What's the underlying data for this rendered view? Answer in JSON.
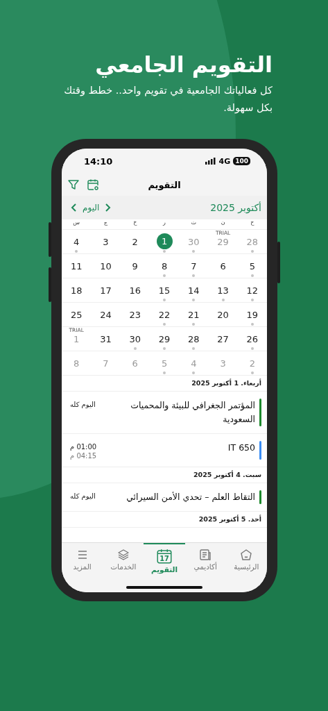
{
  "headline": {
    "title": "التقويم الجامعي",
    "subtitle": "كل فعالياتك الجامعية في تقويم واحد.. خطط وقتك بكل سهولة."
  },
  "status_bar": {
    "time": "14:10",
    "network": "4G",
    "battery": "100"
  },
  "header": {
    "title": "التقويم"
  },
  "month_bar": {
    "month": "أكتوبر 2025",
    "today": "اليوم"
  },
  "weekdays": [
    "ح",
    "ن",
    "ث",
    "ر",
    "خ",
    "ج",
    "س"
  ],
  "days": [
    {
      "day": "28",
      "muted": true,
      "dot": true,
      "selected": false
    },
    {
      "day": "29",
      "muted": true,
      "dot": false,
      "selected": false,
      "tag": "TRIAL"
    },
    {
      "day": "30",
      "muted": true,
      "dot": true,
      "selected": false
    },
    {
      "day": "1",
      "muted": false,
      "dot": true,
      "selected": true
    },
    {
      "day": "2",
      "muted": false,
      "dot": false,
      "selected": false
    },
    {
      "day": "3",
      "muted": false,
      "dot": false,
      "selected": false
    },
    {
      "day": "4",
      "muted": false,
      "dot": true,
      "selected": false
    },
    {
      "day": "5",
      "muted": false,
      "dot": true,
      "selected": false
    },
    {
      "day": "6",
      "muted": false,
      "dot": false,
      "selected": false
    },
    {
      "day": "7",
      "muted": false,
      "dot": true,
      "selected": false
    },
    {
      "day": "8",
      "muted": false,
      "dot": true,
      "selected": false
    },
    {
      "day": "9",
      "muted": false,
      "dot": false,
      "selected": false
    },
    {
      "day": "10",
      "muted": false,
      "dot": false,
      "selected": false
    },
    {
      "day": "11",
      "muted": false,
      "dot": false,
      "selected": false
    },
    {
      "day": "12",
      "muted": false,
      "dot": true,
      "selected": false
    },
    {
      "day": "13",
      "muted": false,
      "dot": true,
      "selected": false
    },
    {
      "day": "14",
      "muted": false,
      "dot": true,
      "selected": false
    },
    {
      "day": "15",
      "muted": false,
      "dot": true,
      "selected": false
    },
    {
      "day": "16",
      "muted": false,
      "dot": false,
      "selected": false
    },
    {
      "day": "17",
      "muted": false,
      "dot": false,
      "selected": false
    },
    {
      "day": "18",
      "muted": false,
      "dot": false,
      "selected": false
    },
    {
      "day": "19",
      "muted": false,
      "dot": true,
      "selected": false
    },
    {
      "day": "20",
      "muted": false,
      "dot": false,
      "selected": false
    },
    {
      "day": "21",
      "muted": false,
      "dot": true,
      "selected": false
    },
    {
      "day": "22",
      "muted": false,
      "dot": true,
      "selected": false
    },
    {
      "day": "23",
      "muted": false,
      "dot": false,
      "selected": false
    },
    {
      "day": "24",
      "muted": false,
      "dot": false,
      "selected": false
    },
    {
      "day": "25",
      "muted": false,
      "dot": false,
      "selected": false
    },
    {
      "day": "26",
      "muted": false,
      "dot": true,
      "selected": false
    },
    {
      "day": "27",
      "muted": false,
      "dot": false,
      "selected": false
    },
    {
      "day": "28",
      "muted": false,
      "dot": true,
      "selected": false
    },
    {
      "day": "29",
      "muted": false,
      "dot": true,
      "selected": false
    },
    {
      "day": "30",
      "muted": false,
      "dot": true,
      "selected": false
    },
    {
      "day": "31",
      "muted": false,
      "dot": false,
      "selected": false
    },
    {
      "day": "1",
      "muted": true,
      "dot": false,
      "selected": false,
      "tag": "TRIAL"
    },
    {
      "day": "2",
      "muted": true,
      "dot": true,
      "selected": false
    },
    {
      "day": "3",
      "muted": true,
      "dot": false,
      "selected": false
    },
    {
      "day": "4",
      "muted": true,
      "dot": true,
      "selected": false
    },
    {
      "day": "5",
      "muted": true,
      "dot": true,
      "selected": false
    },
    {
      "day": "6",
      "muted": true,
      "dot": false,
      "selected": false
    },
    {
      "day": "7",
      "muted": true,
      "dot": false,
      "selected": false
    },
    {
      "day": "8",
      "muted": true,
      "dot": false,
      "selected": false
    }
  ],
  "agenda": [
    {
      "kind": "date",
      "text": "أربعاء. 1 أكتوبر 2025"
    },
    {
      "kind": "event",
      "title": "المؤتمر الجغرافي للبيئة والمحميات السعودية",
      "color": "#1e8a2e",
      "times": [
        "اليوم كله"
      ]
    },
    {
      "kind": "event",
      "title": "IT 650",
      "color": "#3b8ef5",
      "times": [
        "01:00 م",
        "04:15 م"
      ]
    },
    {
      "kind": "date",
      "text": "سبت. 4 أكتوبر 2025"
    },
    {
      "kind": "event",
      "title": "التقاط العلم – تحدي الأمن السيرائي",
      "color": "#1e8a2e",
      "times": [
        "اليوم كله"
      ]
    },
    {
      "kind": "date",
      "text": "أحد. 5 أكتوبر 2025"
    }
  ],
  "tabs": [
    {
      "label": "الرئيسية",
      "selected": false
    },
    {
      "label": "أكاديمي",
      "selected": false
    },
    {
      "label": "التقويم",
      "icon_text": "17",
      "selected": true
    },
    {
      "label": "الخدمات",
      "selected": false
    },
    {
      "label": "المزيد",
      "selected": false
    }
  ]
}
